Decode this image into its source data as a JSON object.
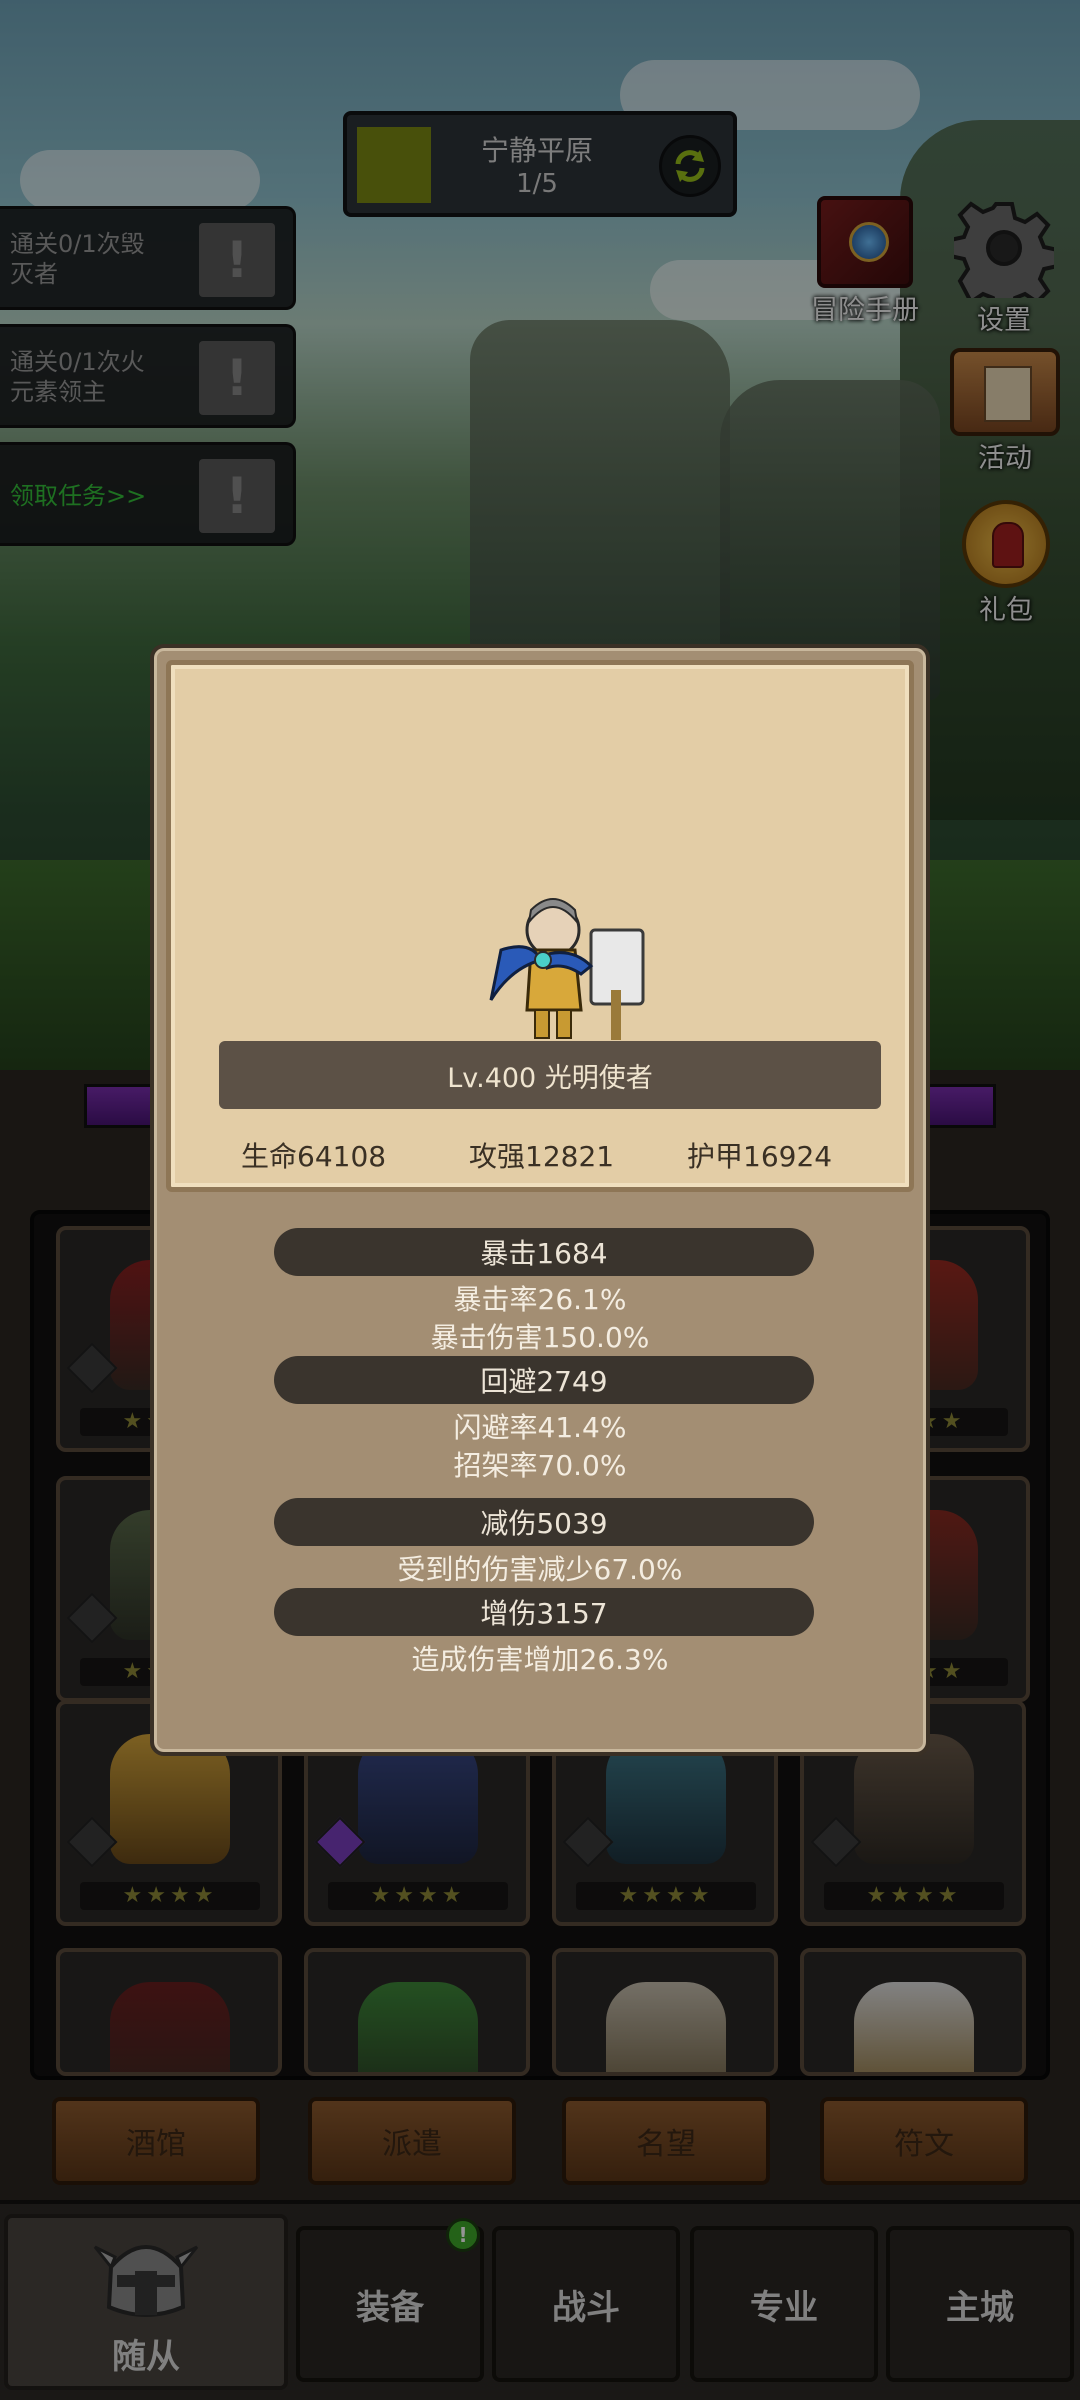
{
  "stage": {
    "name": "宁静平原",
    "progress": "1/5"
  },
  "quests": [
    {
      "text": "通关0/1次毁灭者",
      "line1": "通关0/1次毁",
      "line2": "灭者",
      "alert": "!"
    },
    {
      "text": "通关0/1次火元素领主",
      "line1": "通关0/1次火",
      "line2": "元素领主",
      "alert": "!"
    },
    {
      "text": "领取任务>>",
      "line1": "领取任务>>",
      "line2": "",
      "alert": "!"
    }
  ],
  "side_icons": {
    "handbook": "冒险手册",
    "settings": "设置",
    "activity": "活动",
    "gift": "礼包"
  },
  "hero_card": {
    "name_line": "Lv.400 光明使者",
    "hp": "生命64108",
    "attack": "攻强12821",
    "armor": "护甲16924"
  },
  "stats": {
    "crit": "暴击1684",
    "crit_rate": "暴击率26.1%",
    "crit_damage": "暴击伤害150.0%",
    "evasion": "回避2749",
    "dodge_rate": "闪避率41.4%",
    "parry_rate": "招架率70.0%",
    "reduction": "减伤5039",
    "damage_taken": "受到的伤害减少67.0%",
    "amplify": "增伤3157",
    "damage_dealt": "造成伤害增加26.3%"
  },
  "card_stars": "★★★★",
  "sub_tabs": [
    "酒馆",
    "派遣",
    "名望",
    "符文"
  ],
  "bottom_nav": {
    "followers": "随从",
    "equipment": "装备",
    "battle": "战斗",
    "profession": "专业",
    "main_city": "主城",
    "badge": "!"
  },
  "colors": {
    "quest_link": "#35c23a",
    "dialog_bg": "#a38e73",
    "parchment": "#e3cda6",
    "stat_pill": "#3a342d"
  }
}
